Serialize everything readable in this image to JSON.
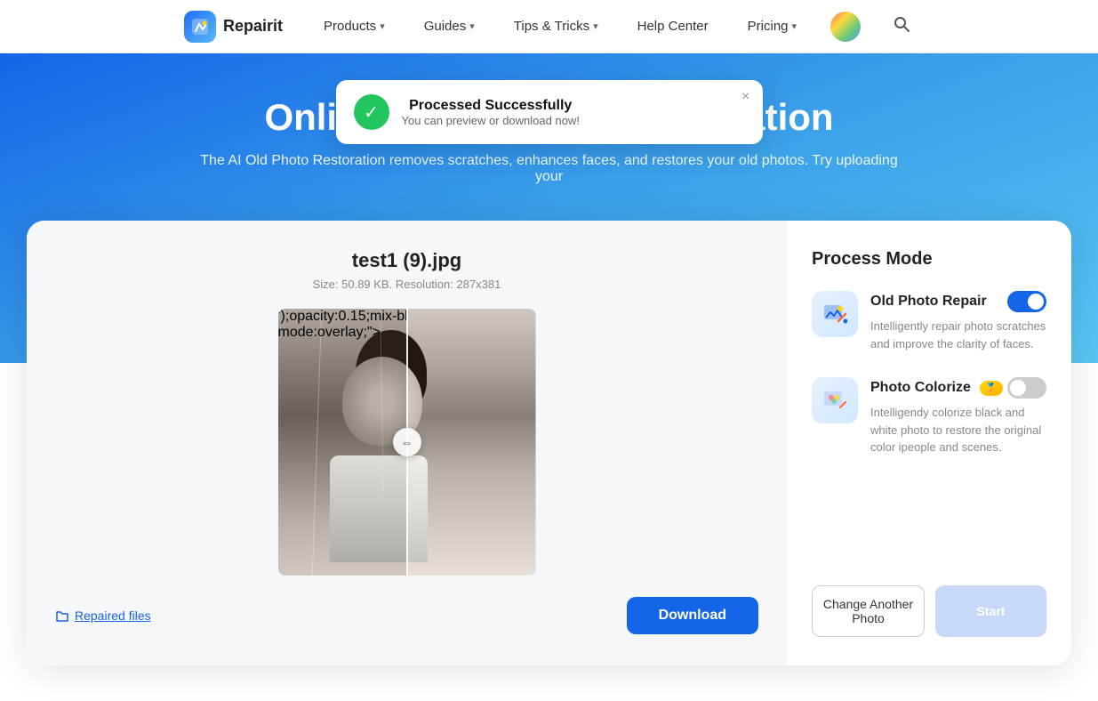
{
  "navbar": {
    "logo_text": "Repairit",
    "items": [
      {
        "label": "Products",
        "has_chevron": true
      },
      {
        "label": "Guides",
        "has_chevron": true
      },
      {
        "label": "Tips & Tricks",
        "has_chevron": true
      },
      {
        "label": "Help Center",
        "has_chevron": false
      },
      {
        "label": "Pricing",
        "has_chevron": true
      }
    ]
  },
  "hero": {
    "title": "Online AI Old Photo Restoration",
    "subtitle": "The AI Old Photo Restoration removes scratches, enhances faces, and restores your old photos. Try uploading your"
  },
  "toast": {
    "title": "Processed Successfully",
    "subtitle": "You can preview or download now!",
    "close_label": "×"
  },
  "file": {
    "name": "test1 (9).jpg",
    "meta": "Size: 50.89 KB. Resolution: 287x381"
  },
  "repaired_link": "Repaired files",
  "download_btn": "Download",
  "process_mode": {
    "title": "Process Mode",
    "modes": [
      {
        "name": "Old Photo Repair",
        "desc": "Intelligently repair photo scratches and improve the clarity of faces.",
        "toggle": "on",
        "premium": false
      },
      {
        "name": "Photo Colorize",
        "desc": "Intelligendy colorize black and white photo to restore the original color ipeople and scenes.",
        "toggle": "off",
        "premium": true
      }
    ]
  },
  "change_photo_btn": "Change Another Photo",
  "start_btn": "Start"
}
